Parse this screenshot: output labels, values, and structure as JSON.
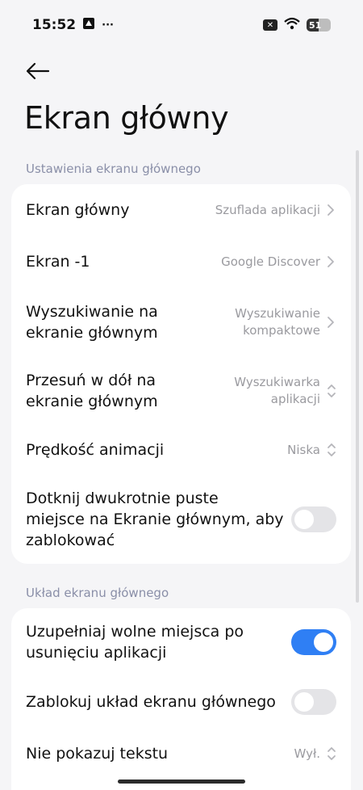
{
  "status": {
    "time": "15:52",
    "more": "···",
    "battery": "51"
  },
  "header": {
    "title": "Ekran główny"
  },
  "section1": {
    "label": "Ustawienia ekranu głównego",
    "rows": [
      {
        "label": "Ekran główny",
        "value": "Szuflada aplikacji",
        "control": "chevron-right"
      },
      {
        "label": "Ekran -1",
        "value": "Google Discover",
        "control": "chevron-right"
      },
      {
        "label_line1": "Wyszukiwanie na",
        "label_line2": "ekranie głównym",
        "value_line1": "Wyszukiwanie",
        "value_line2": "kompaktowe",
        "control": "chevron-right"
      },
      {
        "label_line1": "Przesuń w dół na",
        "label_line2": "ekranie głównym",
        "value_line1": "Wyszukiwarka",
        "value_line2": "aplikacji",
        "control": "chevron-updown"
      },
      {
        "label": "Prędkość animacji",
        "value": "Niska",
        "control": "chevron-updown"
      },
      {
        "label_line1": "Dotknij dwukrotnie puste",
        "label_line2": "miejsce na Ekranie głównym, aby",
        "label_line3": "zablokować",
        "toggle": false
      }
    ]
  },
  "section2": {
    "label": "Układ ekranu głównego",
    "rows": [
      {
        "label_line1": "Uzupełniaj wolne miejsca po",
        "label_line2": "usunięciu aplikacji",
        "toggle": true
      },
      {
        "label": "Zablokuj układ ekranu głównego",
        "toggle": false
      },
      {
        "label": "Nie pokazuj tekstu",
        "value": "Wył.",
        "control": "chevron-updown"
      }
    ]
  },
  "colors": {
    "accent": "#2f7ff4",
    "background": "#f5f5f7",
    "card": "#ffffff",
    "section_label": "#8a8fa8",
    "value_text": "#9a9a9f"
  },
  "icons": {
    "back": "arrow-left-icon",
    "chevron_right": "chevron-right-icon",
    "chevron_updown": "chevron-updown-icon"
  }
}
